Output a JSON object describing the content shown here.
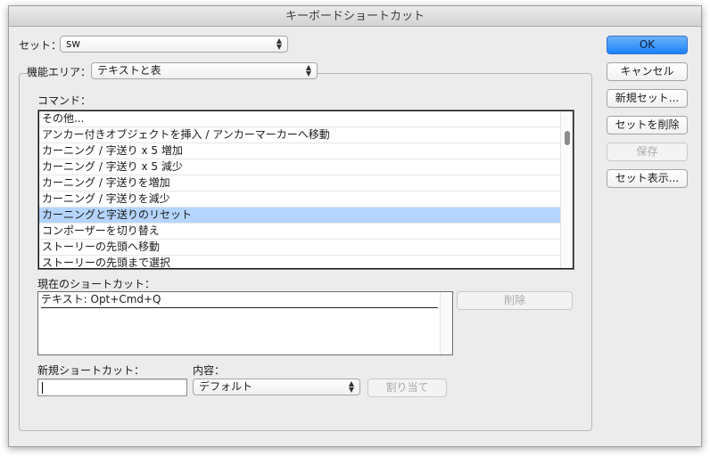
{
  "window": {
    "title": "キーボードショートカット"
  },
  "set": {
    "label": "セット：",
    "value": "sw"
  },
  "area": {
    "label": "機能エリア：",
    "value": "テキストと表"
  },
  "commands": {
    "label": "コマンド：",
    "items": [
      "その他...",
      "アンカー付きオブジェクトを挿入 / アンカーマーカーへ移動",
      "カーニング / 字送り x 5 増加",
      "カーニング / 字送り x 5 減少",
      "カーニング / 字送りを増加",
      "カーニング / 字送りを減少",
      "カーニングと字送りのリセット",
      "コンポーザーを切り替え",
      "ストーリーの先頭へ移動",
      "ストーリーの先頭まで選択"
    ],
    "selected_index": 6
  },
  "current_shortcut": {
    "label": "現在のショートカット：",
    "value": "テキスト: Opt+Cmd+Q",
    "remove_label": "削除"
  },
  "new_shortcut": {
    "label": "新規ショートカット：",
    "value": ""
  },
  "context": {
    "label": "内容：",
    "value": "デフォルト",
    "assign_label": "割り当て"
  },
  "buttons": {
    "ok": "OK",
    "cancel": "キャンセル",
    "new_set": "新規セット...",
    "delete_set": "セットを削除",
    "save": "保存",
    "show_set": "セット表示..."
  },
  "colors": {
    "selection": "#b5d5ff",
    "ok_button": "#1a82fb"
  }
}
